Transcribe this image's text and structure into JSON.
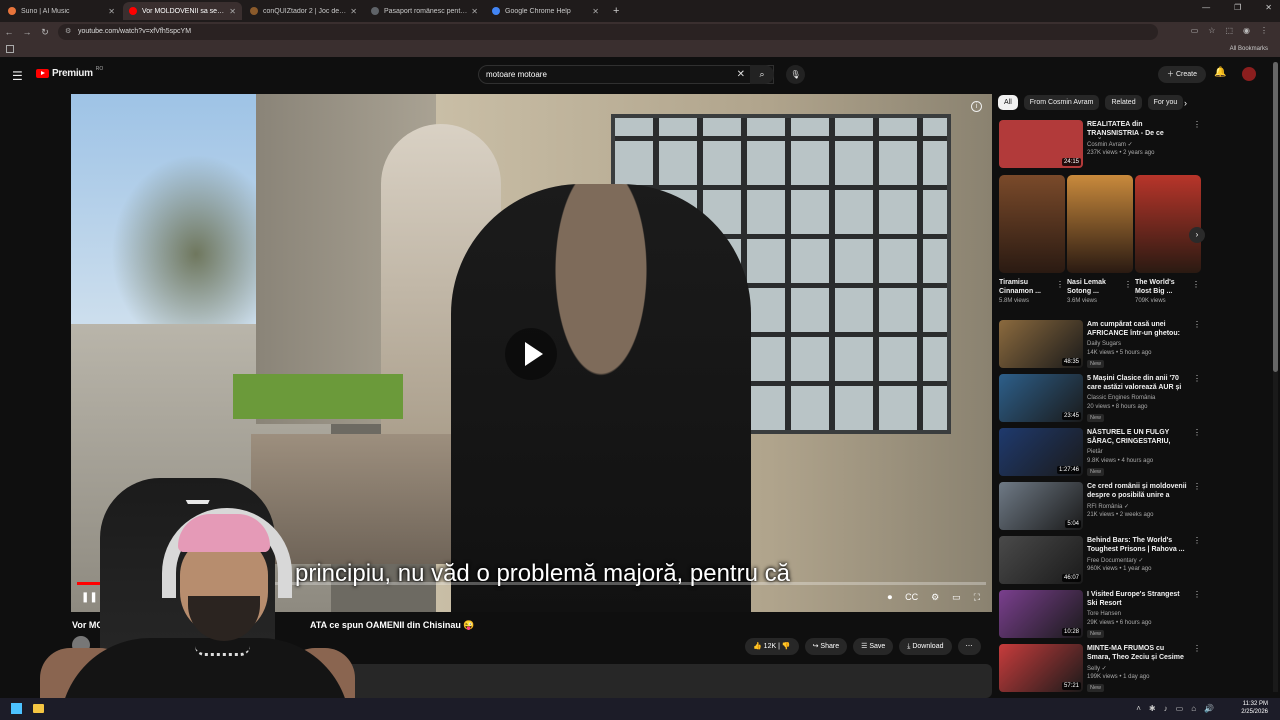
{
  "browser": {
    "tabs": [
      {
        "label": "Suno | AI Music",
        "color": "#e8743b",
        "active": false
      },
      {
        "label": "Vor MOLDOVENII sa se UNEAS",
        "color": "#ff0000",
        "active": true
      },
      {
        "label": "conQUIZtador 2 | Joc de cultura",
        "color": "#8a5a2b",
        "active": false
      },
      {
        "label": "Pasaport românesc pentru mold",
        "color": "#5f6368",
        "active": false
      },
      {
        "label": "Google Chrome Help",
        "color": "#4285f4",
        "active": false
      }
    ],
    "new_tab": "+",
    "url": "youtube.com/watch?v=xfVfh5spcYM",
    "all_bookmarks": "All Bookmarks"
  },
  "header": {
    "logo_text": "Premium",
    "logo_sup": "RO",
    "search_value": "motoare motoare",
    "create_label": "Create"
  },
  "player": {
    "subtitle": "principiu, nu văd o problemă majoră, pentru că",
    "progress_fraction": 0.03
  },
  "video": {
    "title_start": "Vor MOLD",
    "title_end": "ATA ce spun OAMENII din Chisinau 😜",
    "channel_partial": "Co",
    "likes": "12K",
    "share_label": "Share",
    "save_label": "Save",
    "download_label": "Download",
    "desc_partial": "3"
  },
  "sidebar": {
    "chips": [
      {
        "label": "All",
        "selected": true
      },
      {
        "label": "From Cosmin Avram",
        "selected": false
      },
      {
        "label": "Related",
        "selected": false
      },
      {
        "label": "For you",
        "selected": false
      }
    ],
    "first": {
      "title": "REALITATEA din TRANSNISTRIA - De ce URĂS...",
      "channel": "Cosmin Avram ✓",
      "meta": "237K views • 2 years ago",
      "duration": "24:15",
      "color": "#b23a3a"
    },
    "shorts": [
      {
        "title": "Tiramisu Cinnamon ...",
        "views": "5.8M views",
        "color": "#7a4a2a"
      },
      {
        "title": "Nasi Lemak Sotong ...",
        "views": "3.6M views",
        "color": "#c98a3c"
      },
      {
        "title": "The World's Most Big ...",
        "views": "709K views",
        "color": "#b8352a"
      }
    ],
    "items": [
      {
        "title": "Am cumpărat casă unei AFRICANCE într-un ghetou: Că...",
        "channel": "Daily Sugars",
        "meta": "14K views • 5 hours ago",
        "duration": "48:35",
        "badge": "New",
        "color": "#8b6a3e"
      },
      {
        "title": "5 Mașini Clasice din anii '70 care astăzi valorează AUR și ...",
        "channel": "Classic Engines România",
        "meta": "20 views • 8 hours ago",
        "duration": "23:45",
        "badge": "New",
        "color": "#2d5f8a"
      },
      {
        "title": "NĂSTUREL E UN FULGY SĂRAC, CRINGESTARIU, RUX ȘI ...",
        "channel": "Pietär",
        "meta": "9.8K views • 4 hours ago",
        "duration": "1:27:46",
        "badge": "New",
        "color": "#1f3a6e"
      },
      {
        "title": "Ce cred românii și moldovenii despre o posibilă unire a celor ...",
        "channel": "RFI România ✓",
        "meta": "21K views • 2 weeks ago",
        "duration": "5:04",
        "badge": "",
        "color": "#6f7a86"
      },
      {
        "title": "Behind Bars: The World's Toughest Prisons | Rahova ...",
        "channel": "Free Documentary ✓",
        "meta": "960K views • 1 year ago",
        "duration": "46:07",
        "badge": "",
        "color": "#4a4a4a"
      },
      {
        "title": "I Visited Europe's Strangest Ski Resort",
        "channel": "Tore Hansen",
        "meta": "29K views • 6 hours ago",
        "duration": "10:28",
        "badge": "New",
        "color": "#7a3f8e"
      },
      {
        "title": "MINTE-MA FRUMOS cu Smara, Theo Zeciu și Cesime ...",
        "channel": "Selly ✓",
        "meta": "199K views • 1 day ago",
        "duration": "57:21",
        "badge": "New",
        "color": "#c73c3c"
      }
    ]
  },
  "taskbar": {
    "time": "11:32 PM",
    "date": "2/25/2026"
  }
}
